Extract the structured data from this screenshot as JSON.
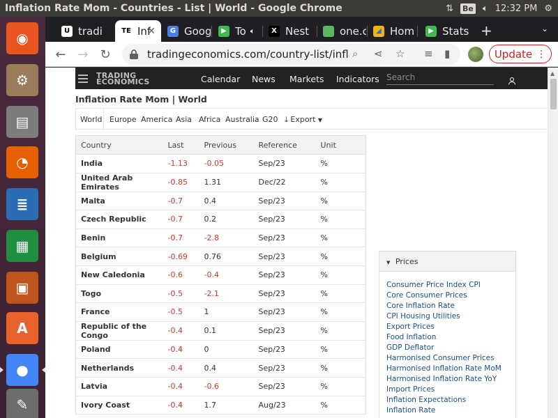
{
  "os": {
    "window_title": "Inflation Rate Mom - Countries - List | World - Google Chrome",
    "keyboard_layout": "Be",
    "clock": "12:32 PM"
  },
  "launcher": [
    {
      "name": "ubuntu-dash",
      "color": "#e95420",
      "glyph": "◉"
    },
    {
      "name": "system-installer",
      "color": "#9a7d5a",
      "glyph": "⚙"
    },
    {
      "name": "files",
      "color": "#7c7c7c",
      "glyph": "▤"
    },
    {
      "name": "firefox",
      "color": "#e66000",
      "glyph": "◔"
    },
    {
      "name": "libreoffice-writer",
      "color": "#2a6db5",
      "glyph": "≣"
    },
    {
      "name": "libreoffice-calc",
      "color": "#1f8f3f",
      "glyph": "▦"
    },
    {
      "name": "libreoffice-impress",
      "color": "#c0541f",
      "glyph": "▣"
    },
    {
      "name": "software-center",
      "color": "#e8622c",
      "glyph": "A"
    },
    {
      "name": "chrome",
      "color": "#4285f4",
      "glyph": "●"
    },
    {
      "name": "text-editor",
      "color": "#6d6d6d",
      "glyph": "✎"
    }
  ],
  "tabs": [
    {
      "title": "tradi",
      "favicon": "U",
      "favicon_bg": "#ffffff",
      "favicon_fg": "#000000"
    },
    {
      "title": "Inf",
      "favicon": "TE",
      "favicon_bg": "#ffffff",
      "favicon_fg": "#000000",
      "active": true
    },
    {
      "title": "Goog",
      "favicon": "G",
      "favicon_bg": "#4a80e8",
      "favicon_fg": "#ffffff"
    },
    {
      "title": "To",
      "favicon": "▶",
      "favicon_bg": "#3fb950",
      "favicon_fg": "#ffffff"
    },
    {
      "title": "Nest",
      "favicon": "X",
      "favicon_bg": "#000000",
      "favicon_fg": "#ffffff"
    },
    {
      "title": "one.c",
      "favicon": "●",
      "favicon_bg": "#5cb85c",
      "favicon_fg": "#5cb85c"
    },
    {
      "title": "Hom",
      "favicon": "◢",
      "favicon_bg": "#f4b400",
      "favicon_fg": "#1a73e8"
    },
    {
      "title": "Stats",
      "favicon": "▶",
      "favicon_bg": "#3fb950",
      "favicon_fg": "#ffffff"
    }
  ],
  "browser": {
    "url": "tradingeconomics.com/country-list/inflatio...",
    "update_label": "Update",
    "new_tab": "+",
    "tab_menu": "⌄"
  },
  "site": {
    "logo_top": "TRADING",
    "logo_bottom": "ECONOMICS",
    "nav": [
      "Calendar",
      "News",
      "Markets",
      "Indicators"
    ],
    "search_placeholder": "Search",
    "page_title": "Inflation Rate Mom | World",
    "regions": [
      "World",
      "Europe",
      "America",
      "Asia",
      "Africa",
      "Australia",
      "G20"
    ],
    "export_label": "Export"
  },
  "table": {
    "headers": [
      "Country",
      "Last",
      "Previous",
      "Reference",
      "Unit"
    ],
    "rows": [
      [
        "India",
        "-1.13",
        "-0.05",
        "Sep/23",
        "%"
      ],
      [
        "United Arab Emirates",
        "-0.85",
        "1.31",
        "Dec/22",
        "%"
      ],
      [
        "Malta",
        "-0.7",
        "0.4",
        "Sep/23",
        "%"
      ],
      [
        "Czech Republic",
        "-0.7",
        "0.2",
        "Sep/23",
        "%"
      ],
      [
        "Benin",
        "-0.7",
        "-2.8",
        "Sep/23",
        "%"
      ],
      [
        "Belgium",
        "-0.69",
        "0.76",
        "Sep/23",
        "%"
      ],
      [
        "New Caledonia",
        "-0.6",
        "-0.4",
        "Sep/23",
        "%"
      ],
      [
        "Togo",
        "-0.5",
        "-2.1",
        "Sep/23",
        "%"
      ],
      [
        "France",
        "-0.5",
        "1",
        "Sep/23",
        "%"
      ],
      [
        "Republic of the Congo",
        "-0.4",
        "0.1",
        "Sep/23",
        "%"
      ],
      [
        "Poland",
        "-0.4",
        "0",
        "Sep/23",
        "%"
      ],
      [
        "Netherlands",
        "-0.4",
        "0.4",
        "Sep/23",
        "%"
      ],
      [
        "Latvia",
        "-0.4",
        "-0.6",
        "Sep/23",
        "%"
      ],
      [
        "Ivory Coast",
        "-0.4",
        "1.7",
        "Aug/23",
        "%"
      ]
    ]
  },
  "prices_panel": {
    "title": "Prices",
    "links": [
      "Consumer Price Index CPI",
      "Core Consumer Prices",
      "Core Inflation Rate",
      "CPI Housing Utilities",
      "Export Prices",
      "Food Inflation",
      "GDP Deflator",
      "Harmonised Consumer Prices",
      "Harmonised Inflation Rate MoM",
      "Harmonised Inflation Rate YoY",
      "Import Prices",
      "Inflation Expectations",
      "Inflation Rate"
    ]
  },
  "colors": {
    "negative": "#c0392b",
    "link": "#1c4e8a",
    "te_header": "#222222",
    "update": "#c5221f"
  }
}
